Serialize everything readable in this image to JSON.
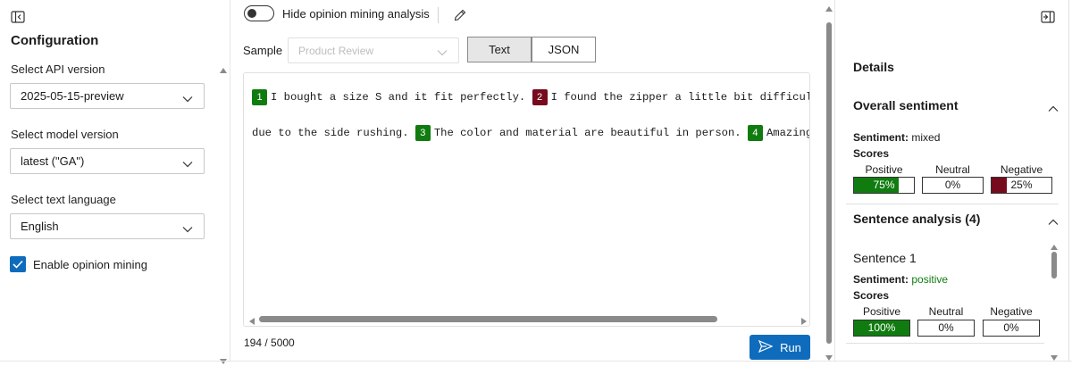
{
  "left": {
    "title": "Configuration",
    "api_label": "Select API version",
    "api_value": "2025-05-15-preview",
    "model_label": "Select model version",
    "model_value": "latest (\"GA\")",
    "lang_label": "Select text language",
    "lang_value": "English",
    "opinion_label": "Enable opinion mining",
    "opinion_checked": true
  },
  "middle": {
    "toggle_label": "Hide opinion mining analysis",
    "sample_label": "Sample",
    "sample_placeholder": "Product Review",
    "tab_text": "Text",
    "tab_json": "JSON",
    "line1": [
      {
        "num": "1",
        "sentiment": "positive",
        "text": "I bought a size S and it fit perfectly."
      },
      {
        "num": "2",
        "sentiment": "negative",
        "text": "I found the zipper a little bit difficult to"
      }
    ],
    "line2_prefix": "due to the side rushing.",
    "line2": [
      {
        "num": "3",
        "sentiment": "positive",
        "text": "The color and material are beautiful in person."
      },
      {
        "num": "4",
        "sentiment": "positive",
        "text": "Amazingly co"
      }
    ],
    "char_count": "194 / 5000",
    "run_label": "Run"
  },
  "right": {
    "details": "Details",
    "overall_title": "Overall sentiment",
    "sentiment_key": "Sentiment:",
    "overall_sentiment": "mixed",
    "scores_label": "Scores",
    "score_headers": [
      "Positive",
      "Neutral",
      "Negative"
    ],
    "overall_scores": {
      "positive": "75%",
      "neutral": "0%",
      "negative": "25%"
    },
    "overall_fill": {
      "positive": 0.75,
      "neutral": 0,
      "negative": 0.25
    },
    "sentence_analysis_title": "Sentence analysis (4)",
    "sentence1_title": "Sentence 1",
    "sentence1_sentiment": "positive",
    "sentence1_scores": {
      "positive": "100%",
      "neutral": "0%",
      "negative": "0%"
    },
    "sentence1_fill": {
      "positive": 1.0,
      "neutral": 0,
      "negative": 0
    }
  },
  "colors": {
    "accent": "#0f6cbd",
    "positive": "#107c10",
    "negative": "#750b1c"
  }
}
